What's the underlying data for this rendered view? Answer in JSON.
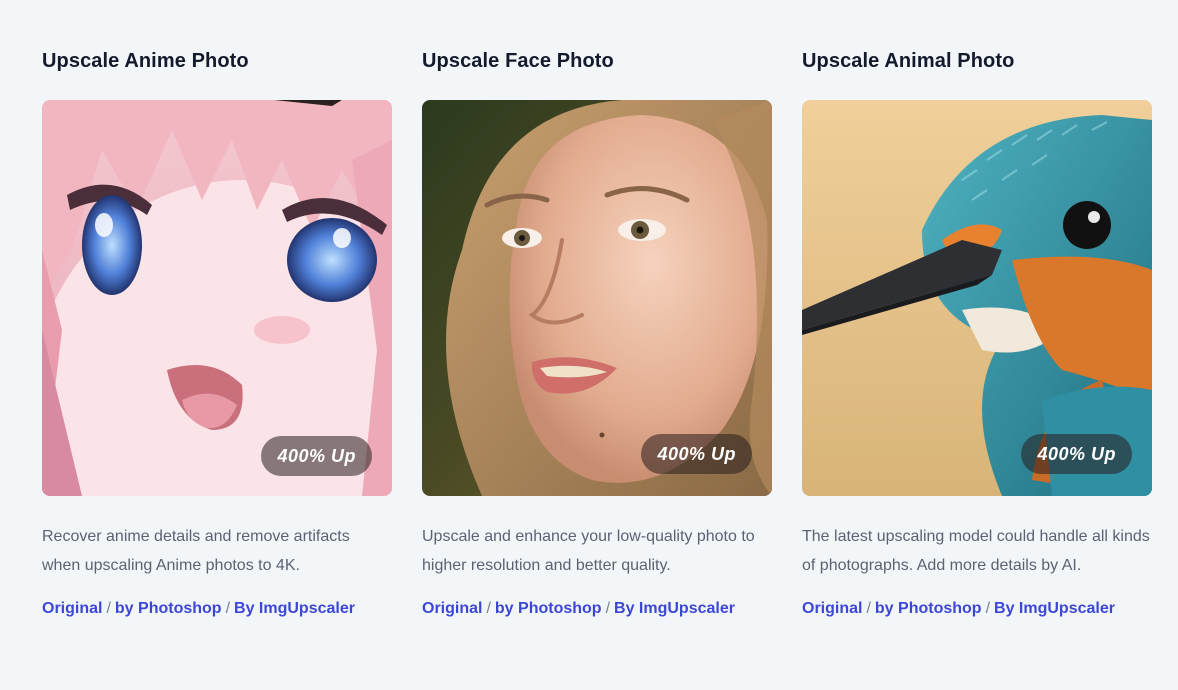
{
  "cards": [
    {
      "title": "Upscale Anime Photo",
      "image": "anime-girl-face",
      "badge": "400% Up",
      "description": "Recover anime details and remove artifacts when upscaling Anime photos to 4K.",
      "links": {
        "original": "Original",
        "sep": "/",
        "photoshop": "by Photoshop",
        "imgupscaler": "By ImgUpscaler"
      }
    },
    {
      "title": "Upscale Face Photo",
      "image": "woman-portrait",
      "badge": "400% Up",
      "description": "Upscale and enhance your low-quality photo to higher resolution and better quality.",
      "links": {
        "original": "Original",
        "sep": "/",
        "photoshop": "by Photoshop",
        "imgupscaler": "By ImgUpscaler"
      }
    },
    {
      "title": "Upscale Animal Photo",
      "image": "kingfisher-bird",
      "badge": "400% Up",
      "description": "The latest upscaling model could handle all kinds of photographs. Add more details by AI.",
      "links": {
        "original": "Original",
        "sep": "/",
        "photoshop": "by Photoshop",
        "imgupscaler": "By ImgUpscaler"
      }
    }
  ],
  "colors": {
    "background": "#f3f6f9",
    "title": "#131a2b",
    "body_text": "#5b6271",
    "link": "#3d47d6"
  }
}
